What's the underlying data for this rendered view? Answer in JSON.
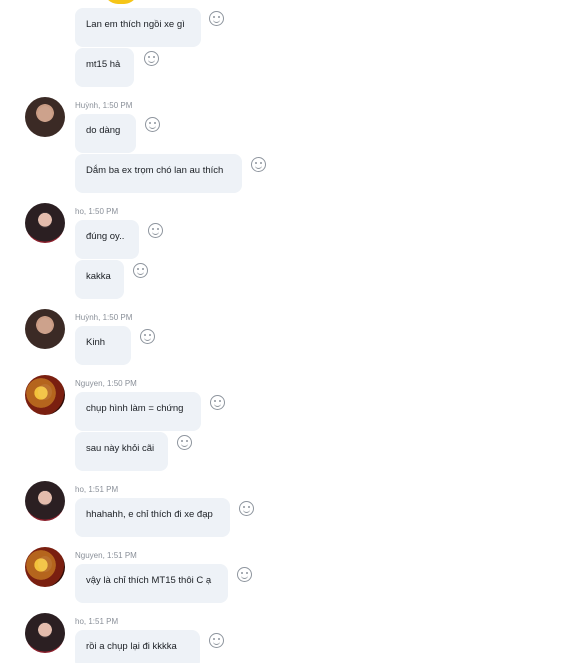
{
  "messages": [
    {
      "text": "Lan em thích ngồi xe gì"
    },
    {
      "text": "mt15 hả"
    },
    {
      "sender": "Huỳnh, 1:50 PM",
      "text": "do dàng"
    },
    {
      "text": "Dắm ba ex trọm chó lan au thích"
    },
    {
      "sender": "ho, 1:50 PM",
      "text": "đúng oy.."
    },
    {
      "text": "kakka"
    },
    {
      "sender": "Huỳnh, 1:50 PM",
      "text": "Kinh"
    },
    {
      "sender": "Nguyen, 1:50 PM",
      "text": "chụp hình làm = chứng"
    },
    {
      "text": "sau này khỏi cãi"
    },
    {
      "sender": "ho, 1:51 PM",
      "text": "hhahahh, e chỉ thích đi xe đạp"
    },
    {
      "sender": "Nguyen, 1:51 PM",
      "text": "vậy là chỉ thích MT15 thôi C ạ"
    },
    {
      "sender": "ho, 1:51 PM",
      "text": "rồi a chụp lại đi   kkkka"
    }
  ],
  "icons": {
    "reaction": "smiley-face-icon",
    "top_sticker": "yellow-emoji-icon"
  }
}
